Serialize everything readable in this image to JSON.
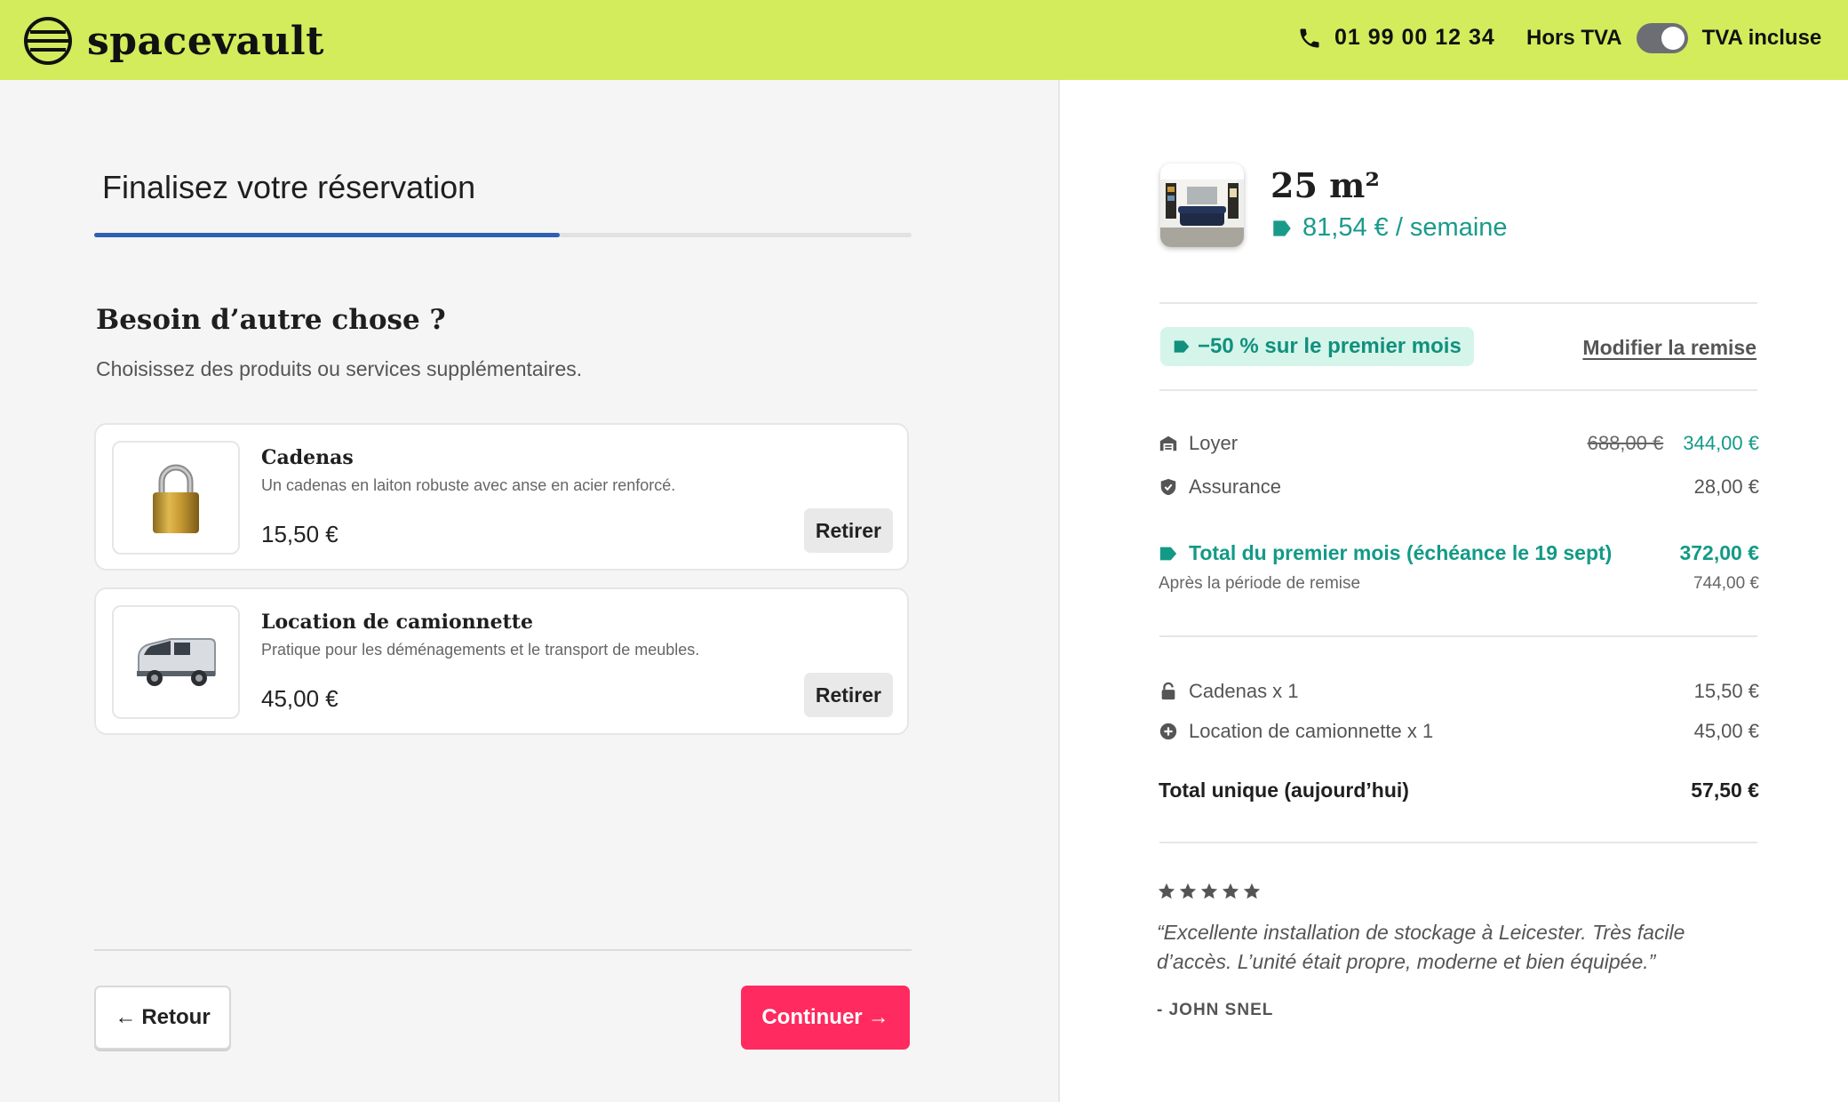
{
  "header": {
    "brand": "spacevault",
    "phone": "01 99 00 12 34",
    "vat_off_label": "Hors TVA",
    "vat_on_label": "TVA incluse",
    "vat_included": true
  },
  "left": {
    "title": "Finalisez votre réservation",
    "progress": 0.57,
    "section_title": "Besoin d’autre chose ?",
    "section_subtitle": "Choisissez des produits ou services supplémentaires.",
    "products": [
      {
        "name": "Cadenas",
        "description": "Un cadenas en laiton robuste avec anse en acier renforcé.",
        "price": "15,50 €",
        "action": "Retirer",
        "icon": "padlock-icon"
      },
      {
        "name": "Location de camionnette",
        "description": "Pratique pour les déménagements et le transport de meubles.",
        "price": "45,00 €",
        "action": "Retirer",
        "icon": "van-icon"
      }
    ],
    "back_label": "Retour",
    "continue_label": "Continuer"
  },
  "summary": {
    "unit_size": "25 m²",
    "unit_price": "81,54 € / semaine",
    "promo": "−50 % sur le premier mois",
    "modify_discount": "Modifier la remise",
    "rent_label": "Loyer",
    "rent_old": "688,00 €",
    "rent_new": "344,00 €",
    "insurance_label": "Assurance",
    "insurance_value": "28,00 €",
    "first_month_label": "Total du premier mois (échéance le 19 sept)",
    "first_month_value": "372,00 €",
    "after_discount_label": "Après la période de remise",
    "after_discount_value": "744,00 €",
    "items": [
      {
        "label": "Cadenas x 1",
        "value": "15,50 €",
        "icon": "lock-icon"
      },
      {
        "label": "Location de camionnette x 1",
        "value": "45,00 €",
        "icon": "plus-circle-icon"
      }
    ],
    "one_time_label": "Total unique (aujourd’hui)",
    "one_time_value": "57,50 €"
  },
  "review": {
    "rating": 5,
    "text": "“Excellente installation de stockage à Leicester. Très facile d’accès. L’unité était propre, moderne et bien équipée.”",
    "author": "- JOHN SNEL"
  },
  "colors": {
    "header_bg": "#d3ec5c",
    "accent_teal": "#139a86",
    "cta_pink": "#ff2a5f",
    "progress_blue": "#2e5fb3"
  }
}
